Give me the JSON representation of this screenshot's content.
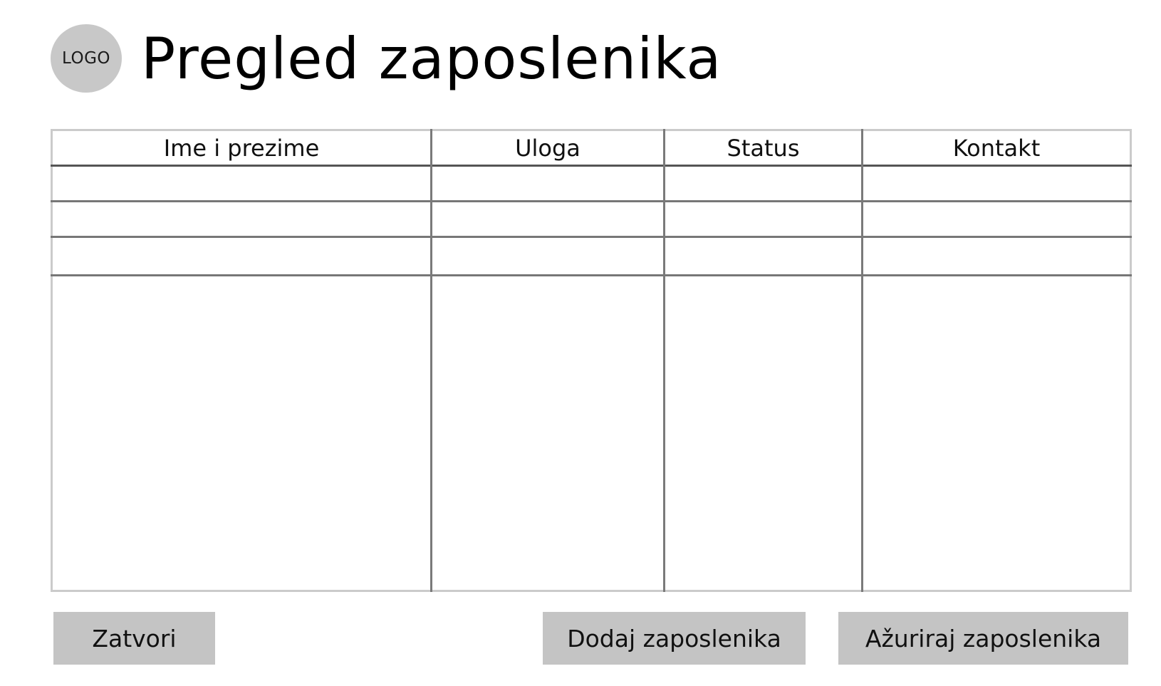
{
  "header": {
    "logo_text": "LOGO",
    "title": "Pregled zaposlenika"
  },
  "table": {
    "columns": [
      {
        "label": "Ime i prezime"
      },
      {
        "label": "Uloga"
      },
      {
        "label": "Status"
      },
      {
        "label": "Kontakt"
      }
    ],
    "rows": [
      [
        "",
        "",
        "",
        ""
      ],
      [
        "",
        "",
        "",
        ""
      ],
      [
        "",
        "",
        "",
        ""
      ]
    ]
  },
  "actions": {
    "close_label": "Zatvori",
    "add_label": "Dodaj zaposlenika",
    "update_label": "Ažuriraj zaposlenika"
  },
  "colors": {
    "logo_bg": "#c8c8c8",
    "button_bg": "#c4c4c4",
    "table_border": "#cbcbcb",
    "grid_line": "#777777"
  }
}
